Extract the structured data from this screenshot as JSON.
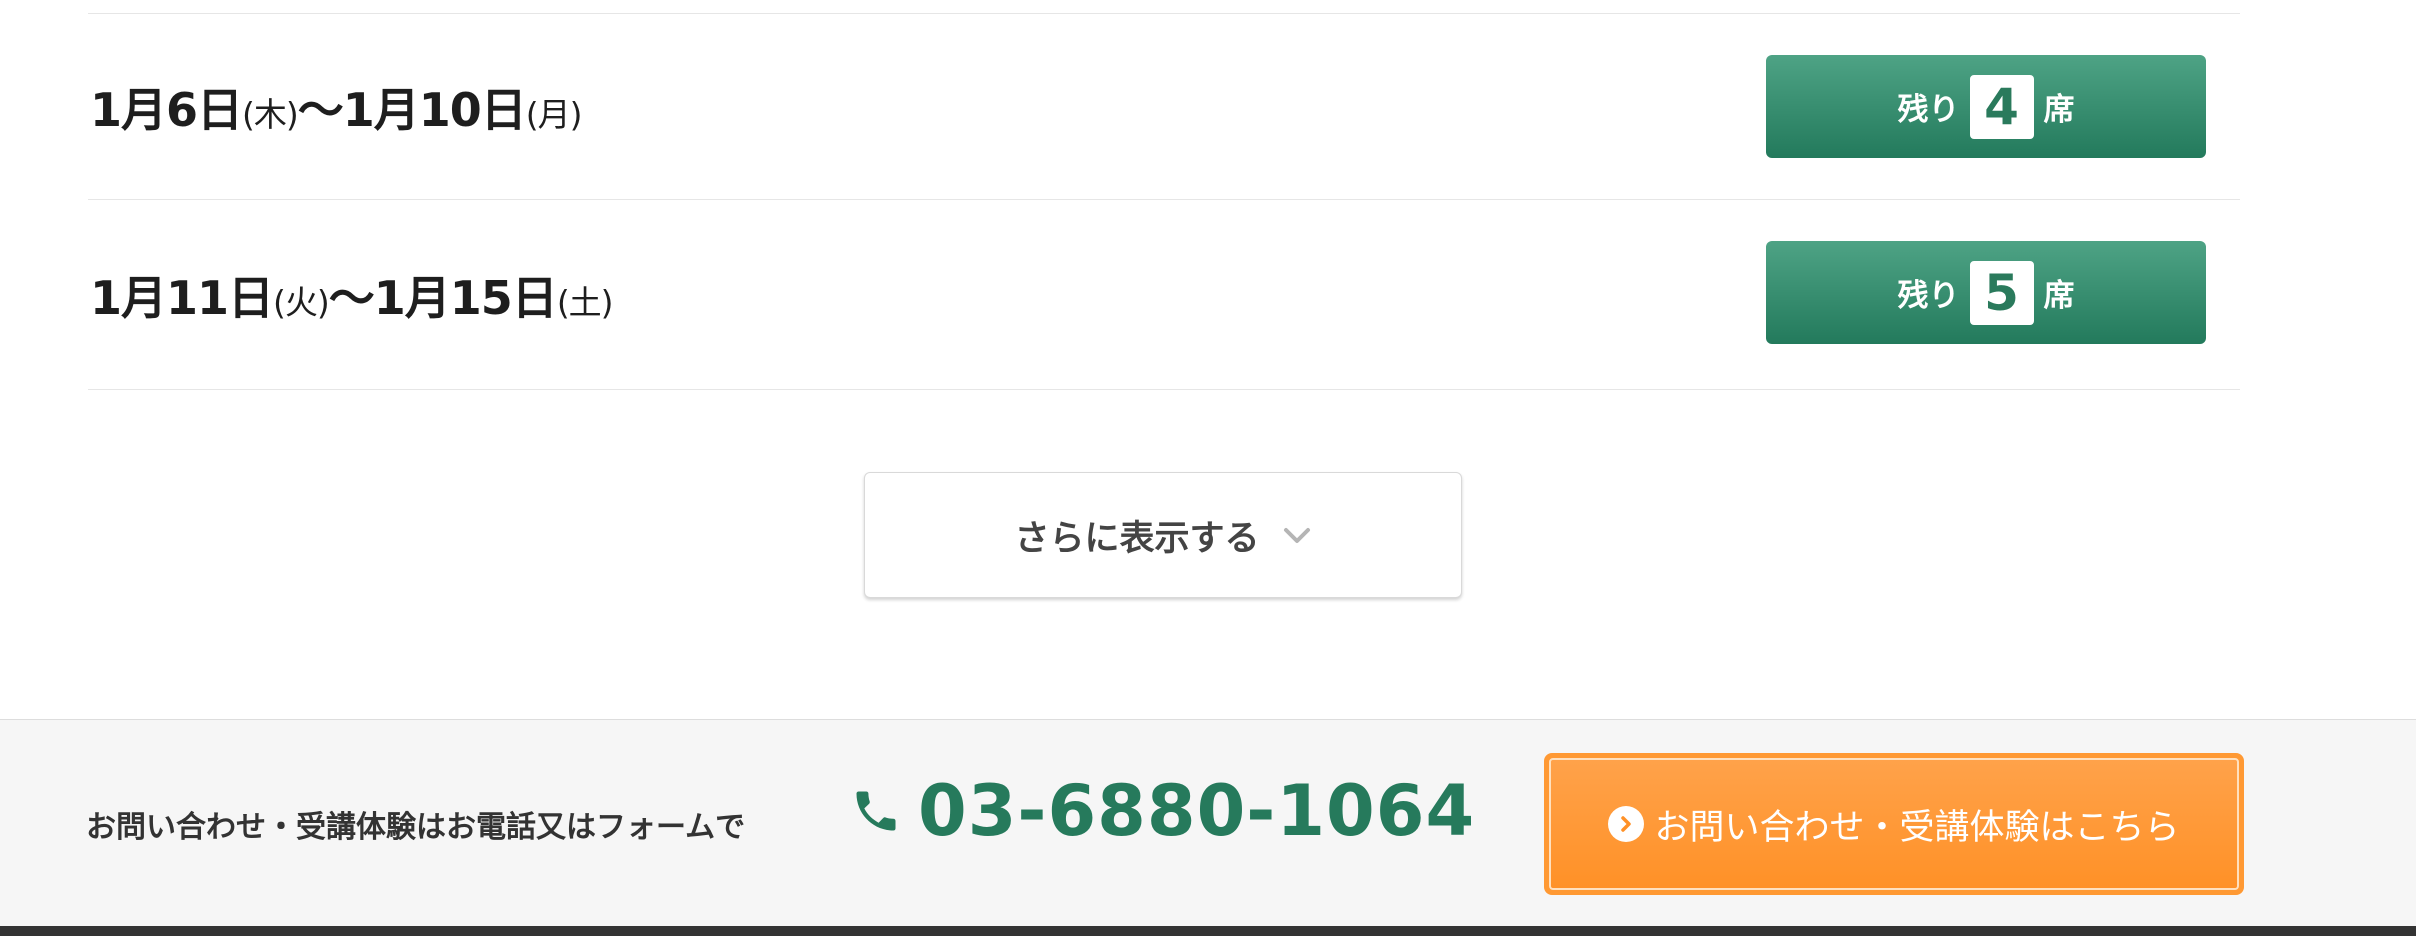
{
  "schedule": {
    "rows": [
      {
        "date_start": "1月6日",
        "dow_start": "(木)",
        "separator": "〜",
        "date_end": "1月10日",
        "dow_end": "(月)",
        "remaining_prefix": "残り",
        "remaining_count": "4",
        "remaining_suffix": "席"
      },
      {
        "date_start": "1月11日",
        "dow_start": "(火)",
        "separator": "〜",
        "date_end": "1月15日",
        "dow_end": "(土)",
        "remaining_prefix": "残り",
        "remaining_count": "5",
        "remaining_suffix": "席"
      }
    ],
    "more_label": "さらに表示する"
  },
  "footer": {
    "contact_text": "お問い合わせ・受講体験はお電話又はフォームで",
    "phone_number": "03-6880-1064",
    "cta_label": "お問い合わせ・受講体験はこちら"
  },
  "colors": {
    "seat_button": "#2e8a69",
    "phone": "#267a5c",
    "cta": "#ff9933",
    "bottom_bar": "#333333"
  },
  "icons": {
    "more": "chevron-down-icon",
    "phone": "phone-icon",
    "cta": "chevron-right-circle-icon"
  }
}
